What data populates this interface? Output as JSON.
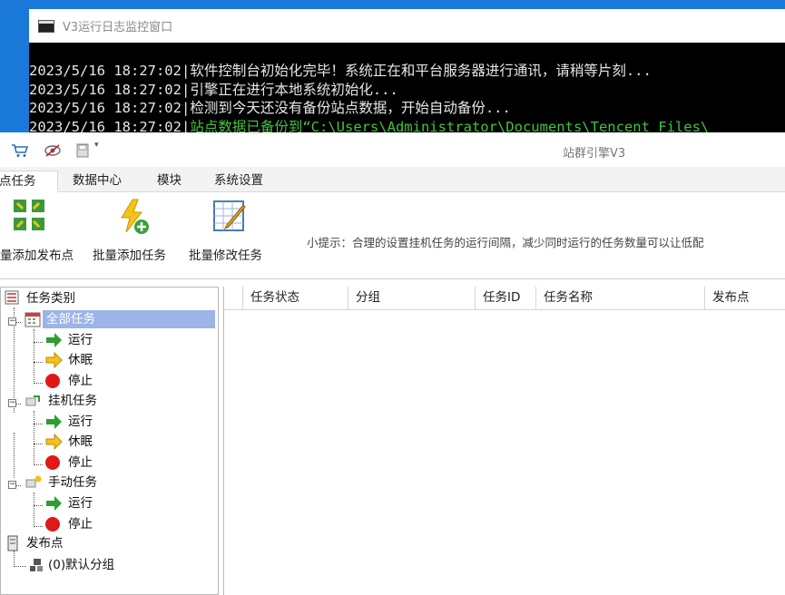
{
  "console": {
    "title": "V3运行日志监控窗口",
    "lines": [
      {
        "ts": "2023/5/16 18:27:02",
        "msg": "软件控制台初始化完毕！系统正在和平台服务器进行通讯，请稍等片刻...",
        "color": "#e6e6e6"
      },
      {
        "ts": "2023/5/16 18:27:02",
        "msg": "引擎正在进行本地系统初始化...",
        "color": "#e6e6e6"
      },
      {
        "ts": "2023/5/16 18:27:02",
        "msg": "检测到今天还没有备份站点数据，开始自动备份...",
        "color": "#e6e6e6"
      },
      {
        "ts": "2023/5/16 18:27:02",
        "msg": "站点数据已备份到“C:\\Users\\Administrator\\Documents\\Tencent Files\\",
        "color": "#43c43c"
      }
    ]
  },
  "app": {
    "title": "站群引擎V3",
    "quick_access": [
      "cart-icon",
      "eye-slash-icon",
      "save-icon",
      "dropdown-icon"
    ]
  },
  "tabs": [
    {
      "label": "站点任务",
      "visible": "点任务",
      "active": true
    },
    {
      "label": "数据中心",
      "active": false
    },
    {
      "label": "模块",
      "active": false
    },
    {
      "label": "系统设置",
      "active": false
    }
  ],
  "ribbon": {
    "buttons": [
      {
        "label": "批量添加发布点",
        "visible": "量添加发布点",
        "icon": "add-publish-point-icon"
      },
      {
        "label": "批量添加任务",
        "icon": "add-task-icon"
      },
      {
        "label": "批量修改任务",
        "icon": "edit-task-icon"
      }
    ],
    "hint": "小提示：合理的设置挂机任务的运行间隔，减少同时运行的任务数量可以让低配"
  },
  "tree": {
    "root": "任务类别",
    "groups": [
      {
        "label": "全部任务",
        "selected": true,
        "children": [
          "运行",
          "休眠",
          "停止"
        ]
      },
      {
        "label": "挂机任务",
        "selected": false,
        "children": [
          "运行",
          "休眠",
          "停止"
        ]
      },
      {
        "label": "手动任务",
        "selected": false,
        "children": [
          "运行",
          "停止"
        ]
      }
    ],
    "publish_root": "发布点",
    "publish_children": [
      "(0)默认分组"
    ]
  },
  "grid": {
    "columns": [
      "任务状态",
      "分组",
      "任务ID",
      "任务名称",
      "发布点"
    ]
  },
  "colors": {
    "desktop": "#1a78d8",
    "console_bg": "#000000",
    "console_green": "#43c43c",
    "tree_selected": "#9cb4e6",
    "run_green": "#2e9e2e",
    "sleep_yellow": "#f4c21a",
    "stop_red": "#e01818"
  }
}
